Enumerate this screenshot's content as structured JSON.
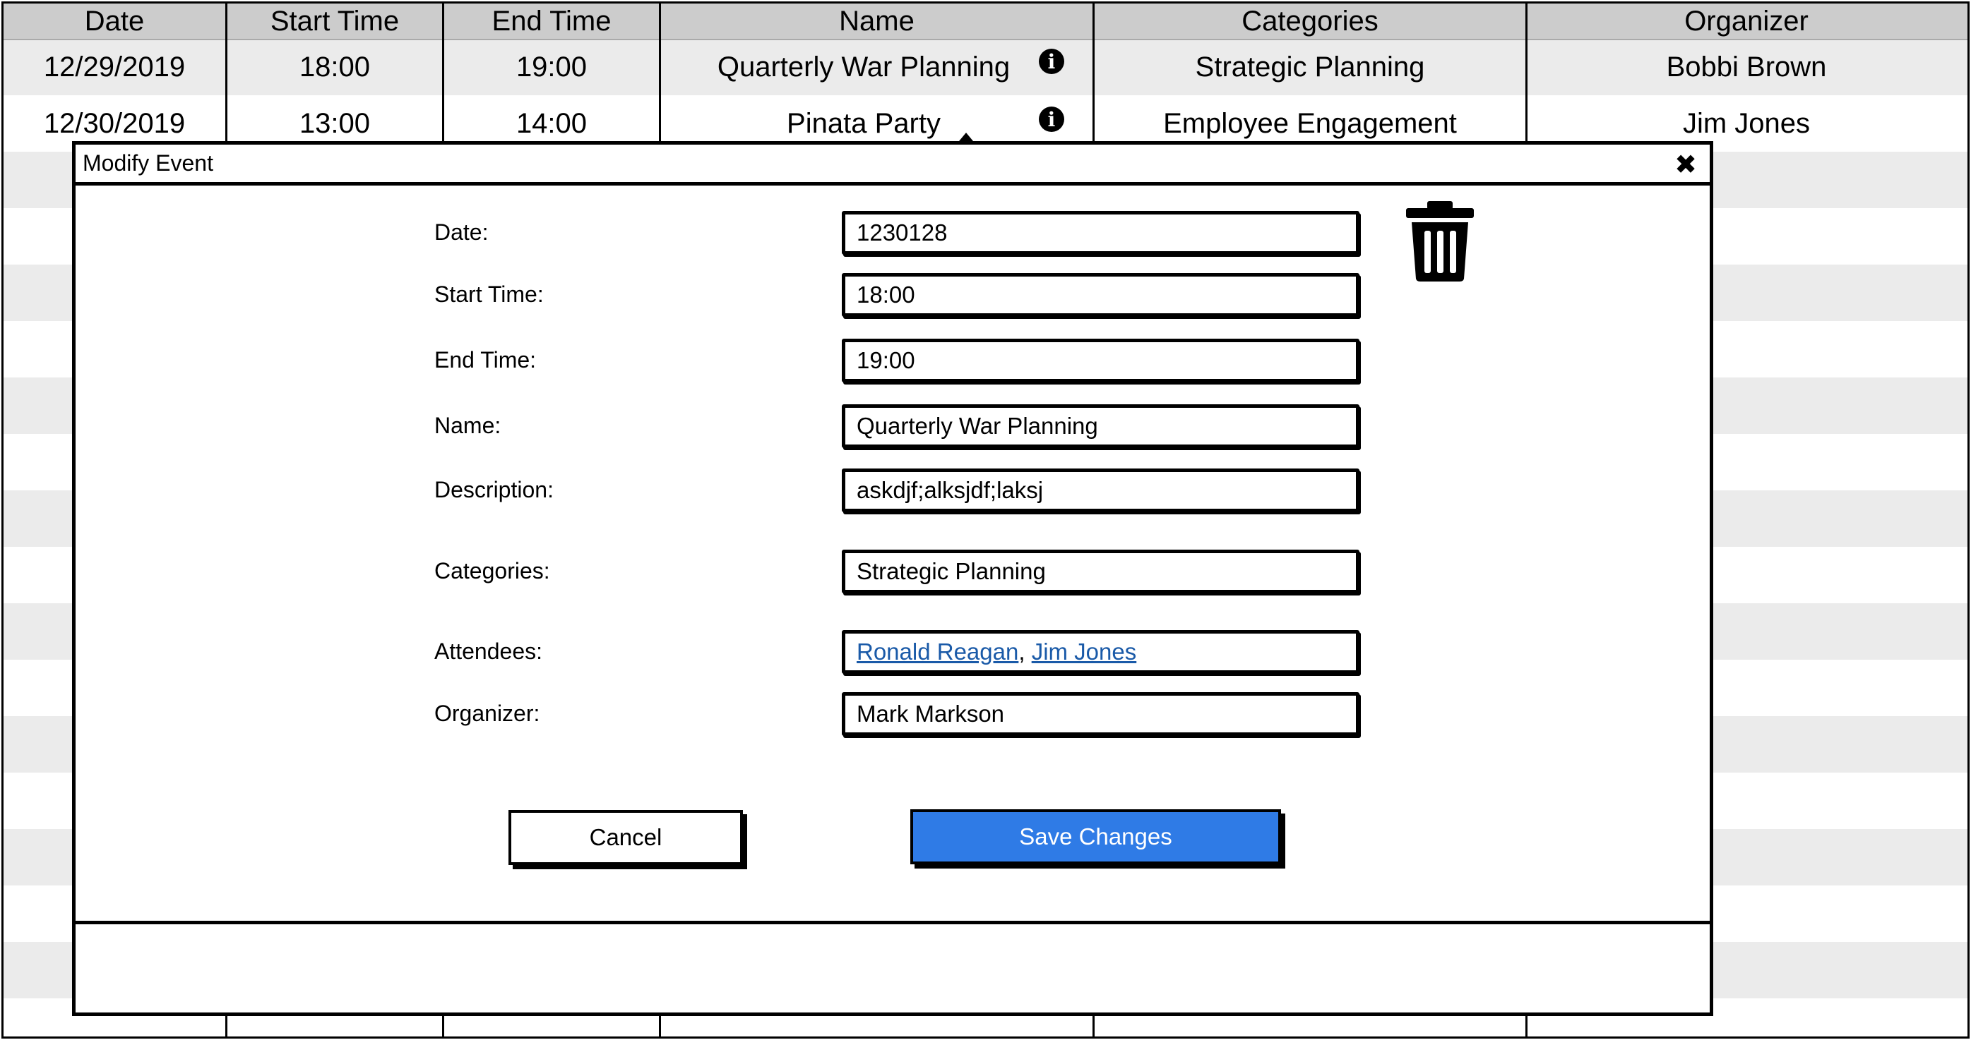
{
  "table": {
    "headers": [
      "Date",
      "Start Time",
      "End Time",
      "Name",
      "Categories",
      "Organizer"
    ],
    "rows": [
      {
        "date": "12/29/2019",
        "start": "18:00",
        "end": "19:00",
        "name": "Quarterly War Planning",
        "categories": "Strategic Planning",
        "organizer": "Bobbi Brown"
      },
      {
        "date": "12/30/2019",
        "start": "13:00",
        "end": "14:00",
        "name": "Pinata Party",
        "categories": "Employee Engagement",
        "organizer": "Jim Jones"
      }
    ]
  },
  "modal": {
    "title": "Modify Event",
    "close_glyph": "✖",
    "fields": {
      "date": {
        "label": "Date:",
        "value": "1230128"
      },
      "start_time": {
        "label": "Start Time:",
        "value": "18:00"
      },
      "end_time": {
        "label": "End Time:",
        "value": "19:00"
      },
      "name": {
        "label": "Name:",
        "value": "Quarterly War Planning"
      },
      "description": {
        "label": "Description:",
        "value": "askdjf;alksjdf;laksj"
      },
      "categories": {
        "label": "Categories:",
        "value": "Strategic Planning"
      },
      "attendees": {
        "label": "Attendees:",
        "people": [
          "Ronald Reagan",
          "Jim Jones"
        ],
        "separator": ", "
      },
      "organizer": {
        "label": "Organizer:",
        "value": "Mark Markson"
      }
    },
    "buttons": {
      "cancel": "Cancel",
      "save": "Save Changes"
    }
  },
  "icons": {
    "info": "info-icon",
    "delete": "trash-icon",
    "close": "close-icon"
  },
  "colors": {
    "primary": "#2f7be6",
    "link": "#1a5aa8",
    "row_alt": "#ebebeb",
    "header_bg": "#cccccc"
  }
}
